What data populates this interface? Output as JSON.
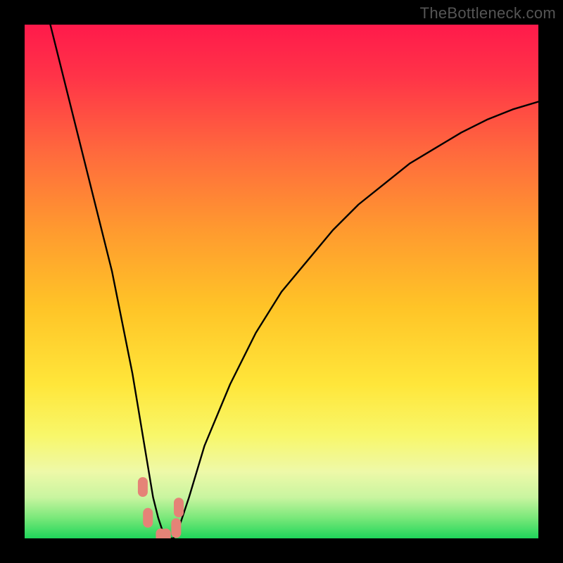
{
  "watermark": "TheBottleneck.com",
  "chart_data": {
    "type": "line",
    "title": "",
    "xlabel": "",
    "ylabel": "",
    "xlim": [
      0,
      100
    ],
    "ylim": [
      0,
      100
    ],
    "curve": {
      "x": [
        5,
        8,
        11,
        14,
        17,
        19,
        21,
        22,
        23,
        24,
        25,
        26,
        27,
        28,
        29,
        30,
        32,
        35,
        40,
        45,
        50,
        55,
        60,
        65,
        70,
        75,
        80,
        85,
        90,
        95,
        100
      ],
      "y": [
        100,
        88,
        76,
        64,
        52,
        42,
        32,
        26,
        20,
        14,
        8,
        4,
        1,
        0,
        0,
        2,
        8,
        18,
        30,
        40,
        48,
        54,
        60,
        65,
        69,
        73,
        76,
        79,
        81.5,
        83.5,
        85
      ]
    },
    "valley_markers": {
      "x": [
        23,
        24,
        26.5,
        27.5,
        29.5,
        30
      ],
      "y": [
        10,
        4,
        0,
        0,
        2,
        6
      ]
    },
    "gradient_stops": [
      {
        "offset": 0.0,
        "color": "#ff1a4b"
      },
      {
        "offset": 0.1,
        "color": "#ff3348"
      },
      {
        "offset": 0.25,
        "color": "#ff6a3d"
      },
      {
        "offset": 0.4,
        "color": "#ff9a2f"
      },
      {
        "offset": 0.55,
        "color": "#ffc427"
      },
      {
        "offset": 0.7,
        "color": "#ffe63a"
      },
      {
        "offset": 0.8,
        "color": "#f8f76a"
      },
      {
        "offset": 0.87,
        "color": "#eef9a8"
      },
      {
        "offset": 0.92,
        "color": "#c9f5a0"
      },
      {
        "offset": 0.96,
        "color": "#7ae87a"
      },
      {
        "offset": 1.0,
        "color": "#1fd65a"
      }
    ],
    "marker_color": "#e58377",
    "curve_color": "#000000"
  }
}
